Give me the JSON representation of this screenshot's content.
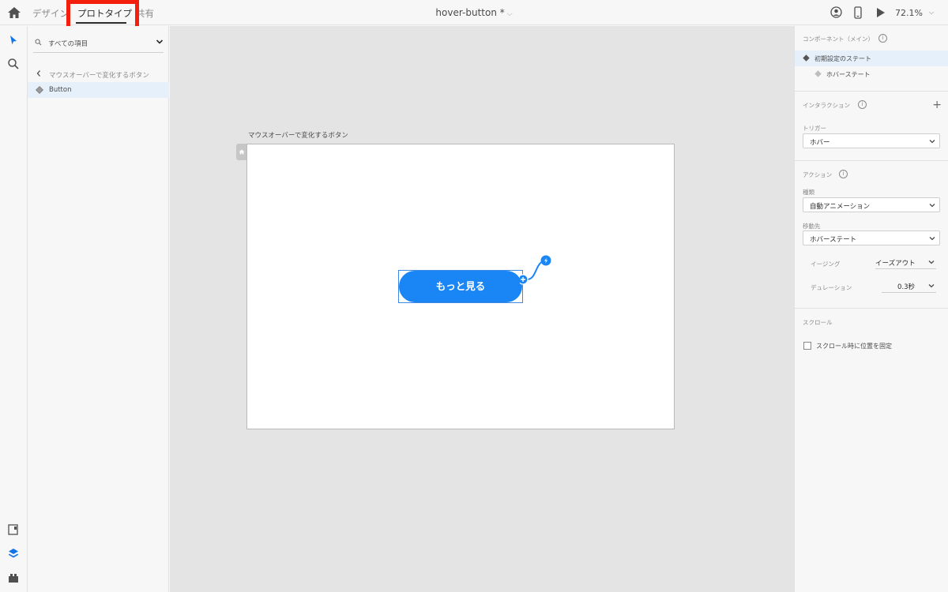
{
  "topbar": {
    "tabs": [
      "デザイン",
      "プロトタイプ",
      "共有"
    ],
    "doc_title": "hover-button *",
    "zoom": "72.1%"
  },
  "left_panel": {
    "search_label": "すべての項目",
    "back_label": "マウスオーバーで変化するボタン",
    "item_label": "Button"
  },
  "canvas": {
    "artboard_title": "マウスオーバーで変化するボタン",
    "button_label": "もっと見る"
  },
  "right_panel": {
    "component_title": "コンポーネント（メイン）",
    "states": [
      "初期設定のステート",
      "ホバーステート"
    ],
    "interaction_title": "インタラクション",
    "trigger_label": "トリガー",
    "trigger_value": "ホバー",
    "action_title": "アクション",
    "type_label": "種類",
    "type_value": "自動アニメーション",
    "dest_label": "移動先",
    "dest_value": "ホバーステート",
    "easing_label": "イージング",
    "easing_value": "イーズアウト",
    "duration_label": "デュレーション",
    "duration_value": "0.3秒",
    "scroll_title": "スクロール",
    "scroll_checkbox_label": "スクロール時に位置を固定"
  },
  "colors": {
    "accent": "#1a86f5",
    "highlight_box": "#f41e0c"
  }
}
